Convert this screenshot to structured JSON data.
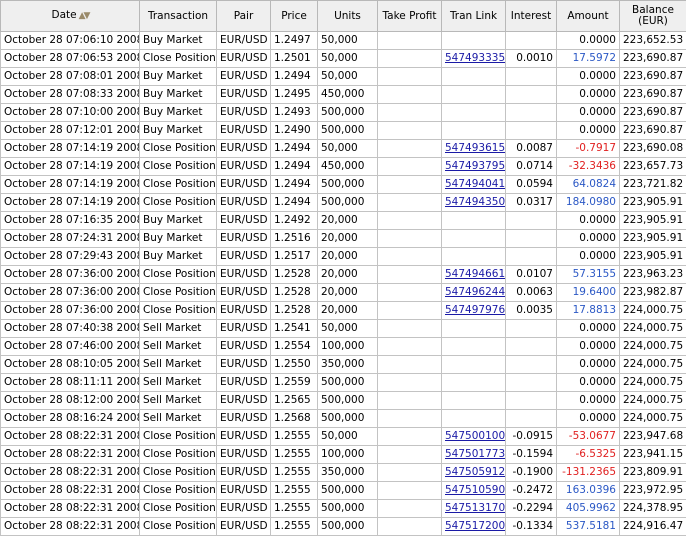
{
  "headers": {
    "date": "Date",
    "date_sort_icon": "sort-arrows-icon",
    "transaction": "Transaction",
    "pair": "Pair",
    "price": "Price",
    "units": "Units",
    "take_profit": "Take Profit",
    "tran_link": "Tran Link",
    "interest": "Interest",
    "amount": "Amount",
    "balance_line1": "Balance",
    "balance_line2": "(EUR)"
  },
  "colors": {
    "positive": "#2b58c5",
    "negative": "#e02020",
    "link": "#1a1aa6"
  },
  "rows": [
    {
      "date": "October 28 07:06:10 2008",
      "transaction": "Buy Market",
      "pair": "EUR/USD",
      "price": "1.2497",
      "units": "50,000",
      "take_profit": "",
      "tran_link": "",
      "interest": "",
      "amount": "0.0000",
      "balance": "223,652.53"
    },
    {
      "date": "October 28 07:06:53 2008",
      "transaction": "Close Position",
      "pair": "EUR/USD",
      "price": "1.2501",
      "units": "50,000",
      "take_profit": "",
      "tran_link": "547493335",
      "interest": "0.0010",
      "amount": "17.5972",
      "balance": "223,690.87"
    },
    {
      "date": "October 28 07:08:01 2008",
      "transaction": "Buy Market",
      "pair": "EUR/USD",
      "price": "1.2494",
      "units": "50,000",
      "take_profit": "",
      "tran_link": "",
      "interest": "",
      "amount": "0.0000",
      "balance": "223,690.87"
    },
    {
      "date": "October 28 07:08:33 2008",
      "transaction": "Buy Market",
      "pair": "EUR/USD",
      "price": "1.2495",
      "units": "450,000",
      "take_profit": "",
      "tran_link": "",
      "interest": "",
      "amount": "0.0000",
      "balance": "223,690.87"
    },
    {
      "date": "October 28 07:10:00 2008",
      "transaction": "Buy Market",
      "pair": "EUR/USD",
      "price": "1.2493",
      "units": "500,000",
      "take_profit": "",
      "tran_link": "",
      "interest": "",
      "amount": "0.0000",
      "balance": "223,690.87"
    },
    {
      "date": "October 28 07:12:01 2008",
      "transaction": "Buy Market",
      "pair": "EUR/USD",
      "price": "1.2490",
      "units": "500,000",
      "take_profit": "",
      "tran_link": "",
      "interest": "",
      "amount": "0.0000",
      "balance": "223,690.87"
    },
    {
      "date": "October 28 07:14:19 2008",
      "transaction": "Close Position",
      "pair": "EUR/USD",
      "price": "1.2494",
      "units": "50,000",
      "take_profit": "",
      "tran_link": "547493615",
      "interest": "0.0087",
      "amount": "-0.7917",
      "balance": "223,690.08"
    },
    {
      "date": "October 28 07:14:19 2008",
      "transaction": "Close Position",
      "pair": "EUR/USD",
      "price": "1.2494",
      "units": "450,000",
      "take_profit": "",
      "tran_link": "547493795",
      "interest": "0.0714",
      "amount": "-32.3436",
      "balance": "223,657.73"
    },
    {
      "date": "October 28 07:14:19 2008",
      "transaction": "Close Position",
      "pair": "EUR/USD",
      "price": "1.2494",
      "units": "500,000",
      "take_profit": "",
      "tran_link": "547494041",
      "interest": "0.0594",
      "amount": "64.0824",
      "balance": "223,721.82"
    },
    {
      "date": "October 28 07:14:19 2008",
      "transaction": "Close Position",
      "pair": "EUR/USD",
      "price": "1.2494",
      "units": "500,000",
      "take_profit": "",
      "tran_link": "547494350",
      "interest": "0.0317",
      "amount": "184.0980",
      "balance": "223,905.91"
    },
    {
      "date": "October 28 07:16:35 2008",
      "transaction": "Buy Market",
      "pair": "EUR/USD",
      "price": "1.2492",
      "units": "20,000",
      "take_profit": "",
      "tran_link": "",
      "interest": "",
      "amount": "0.0000",
      "balance": "223,905.91"
    },
    {
      "date": "October 28 07:24:31 2008",
      "transaction": "Buy Market",
      "pair": "EUR/USD",
      "price": "1.2516",
      "units": "20,000",
      "take_profit": "",
      "tran_link": "",
      "interest": "",
      "amount": "0.0000",
      "balance": "223,905.91"
    },
    {
      "date": "October 28 07:29:43 2008",
      "transaction": "Buy Market",
      "pair": "EUR/USD",
      "price": "1.2517",
      "units": "20,000",
      "take_profit": "",
      "tran_link": "",
      "interest": "",
      "amount": "0.0000",
      "balance": "223,905.91"
    },
    {
      "date": "October 28 07:36:00 2008",
      "transaction": "Close Position",
      "pair": "EUR/USD",
      "price": "1.2528",
      "units": "20,000",
      "take_profit": "",
      "tran_link": "547494661",
      "interest": "0.0107",
      "amount": "57.3155",
      "balance": "223,963.23"
    },
    {
      "date": "October 28 07:36:00 2008",
      "transaction": "Close Position",
      "pair": "EUR/USD",
      "price": "1.2528",
      "units": "20,000",
      "take_profit": "",
      "tran_link": "547496244",
      "interest": "0.0063",
      "amount": "19.6400",
      "balance": "223,982.87"
    },
    {
      "date": "October 28 07:36:00 2008",
      "transaction": "Close Position",
      "pair": "EUR/USD",
      "price": "1.2528",
      "units": "20,000",
      "take_profit": "",
      "tran_link": "547497976",
      "interest": "0.0035",
      "amount": "17.8813",
      "balance": "224,000.75"
    },
    {
      "date": "October 28 07:40:38 2008",
      "transaction": "Sell Market",
      "pair": "EUR/USD",
      "price": "1.2541",
      "units": "50,000",
      "take_profit": "",
      "tran_link": "",
      "interest": "",
      "amount": "0.0000",
      "balance": "224,000.75"
    },
    {
      "date": "October 28 07:46:00 2008",
      "transaction": "Sell Market",
      "pair": "EUR/USD",
      "price": "1.2554",
      "units": "100,000",
      "take_profit": "",
      "tran_link": "",
      "interest": "",
      "amount": "0.0000",
      "balance": "224,000.75"
    },
    {
      "date": "October 28 08:10:05 2008",
      "transaction": "Sell Market",
      "pair": "EUR/USD",
      "price": "1.2550",
      "units": "350,000",
      "take_profit": "",
      "tran_link": "",
      "interest": "",
      "amount": "0.0000",
      "balance": "224,000.75"
    },
    {
      "date": "October 28 08:11:11 2008",
      "transaction": "Sell Market",
      "pair": "EUR/USD",
      "price": "1.2559",
      "units": "500,000",
      "take_profit": "",
      "tran_link": "",
      "interest": "",
      "amount": "0.0000",
      "balance": "224,000.75"
    },
    {
      "date": "October 28 08:12:00 2008",
      "transaction": "Sell Market",
      "pair": "EUR/USD",
      "price": "1.2565",
      "units": "500,000",
      "take_profit": "",
      "tran_link": "",
      "interest": "",
      "amount": "0.0000",
      "balance": "224,000.75"
    },
    {
      "date": "October 28 08:16:24 2008",
      "transaction": "Sell Market",
      "pair": "EUR/USD",
      "price": "1.2568",
      "units": "500,000",
      "take_profit": "",
      "tran_link": "",
      "interest": "",
      "amount": "0.0000",
      "balance": "224,000.75"
    },
    {
      "date": "October 28 08:22:31 2008",
      "transaction": "Close Position",
      "pair": "EUR/USD",
      "price": "1.2555",
      "units": "50,000",
      "take_profit": "",
      "tran_link": "547500100",
      "interest": "-0.0915",
      "amount": "-53.0677",
      "balance": "223,947.68"
    },
    {
      "date": "October 28 08:22:31 2008",
      "transaction": "Close Position",
      "pair": "EUR/USD",
      "price": "1.2555",
      "units": "100,000",
      "take_profit": "",
      "tran_link": "547501773",
      "interest": "-0.1594",
      "amount": "-6.5325",
      "balance": "223,941.15"
    },
    {
      "date": "October 28 08:22:31 2008",
      "transaction": "Close Position",
      "pair": "EUR/USD",
      "price": "1.2555",
      "units": "350,000",
      "take_profit": "",
      "tran_link": "547505912",
      "interest": "-0.1900",
      "amount": "-131.2365",
      "balance": "223,809.91"
    },
    {
      "date": "October 28 08:22:31 2008",
      "transaction": "Close Position",
      "pair": "EUR/USD",
      "price": "1.2555",
      "units": "500,000",
      "take_profit": "",
      "tran_link": "547510590",
      "interest": "-0.2472",
      "amount": "163.0396",
      "balance": "223,972.95"
    },
    {
      "date": "October 28 08:22:31 2008",
      "transaction": "Close Position",
      "pair": "EUR/USD",
      "price": "1.2555",
      "units": "500,000",
      "take_profit": "",
      "tran_link": "547513170",
      "interest": "-0.2294",
      "amount": "405.9962",
      "balance": "224,378.95"
    },
    {
      "date": "October 28 08:22:31 2008",
      "transaction": "Close Position",
      "pair": "EUR/USD",
      "price": "1.2555",
      "units": "500,000",
      "take_profit": "",
      "tran_link": "547517200",
      "interest": "-0.1334",
      "amount": "537.5181",
      "balance": "224,916.47"
    }
  ]
}
